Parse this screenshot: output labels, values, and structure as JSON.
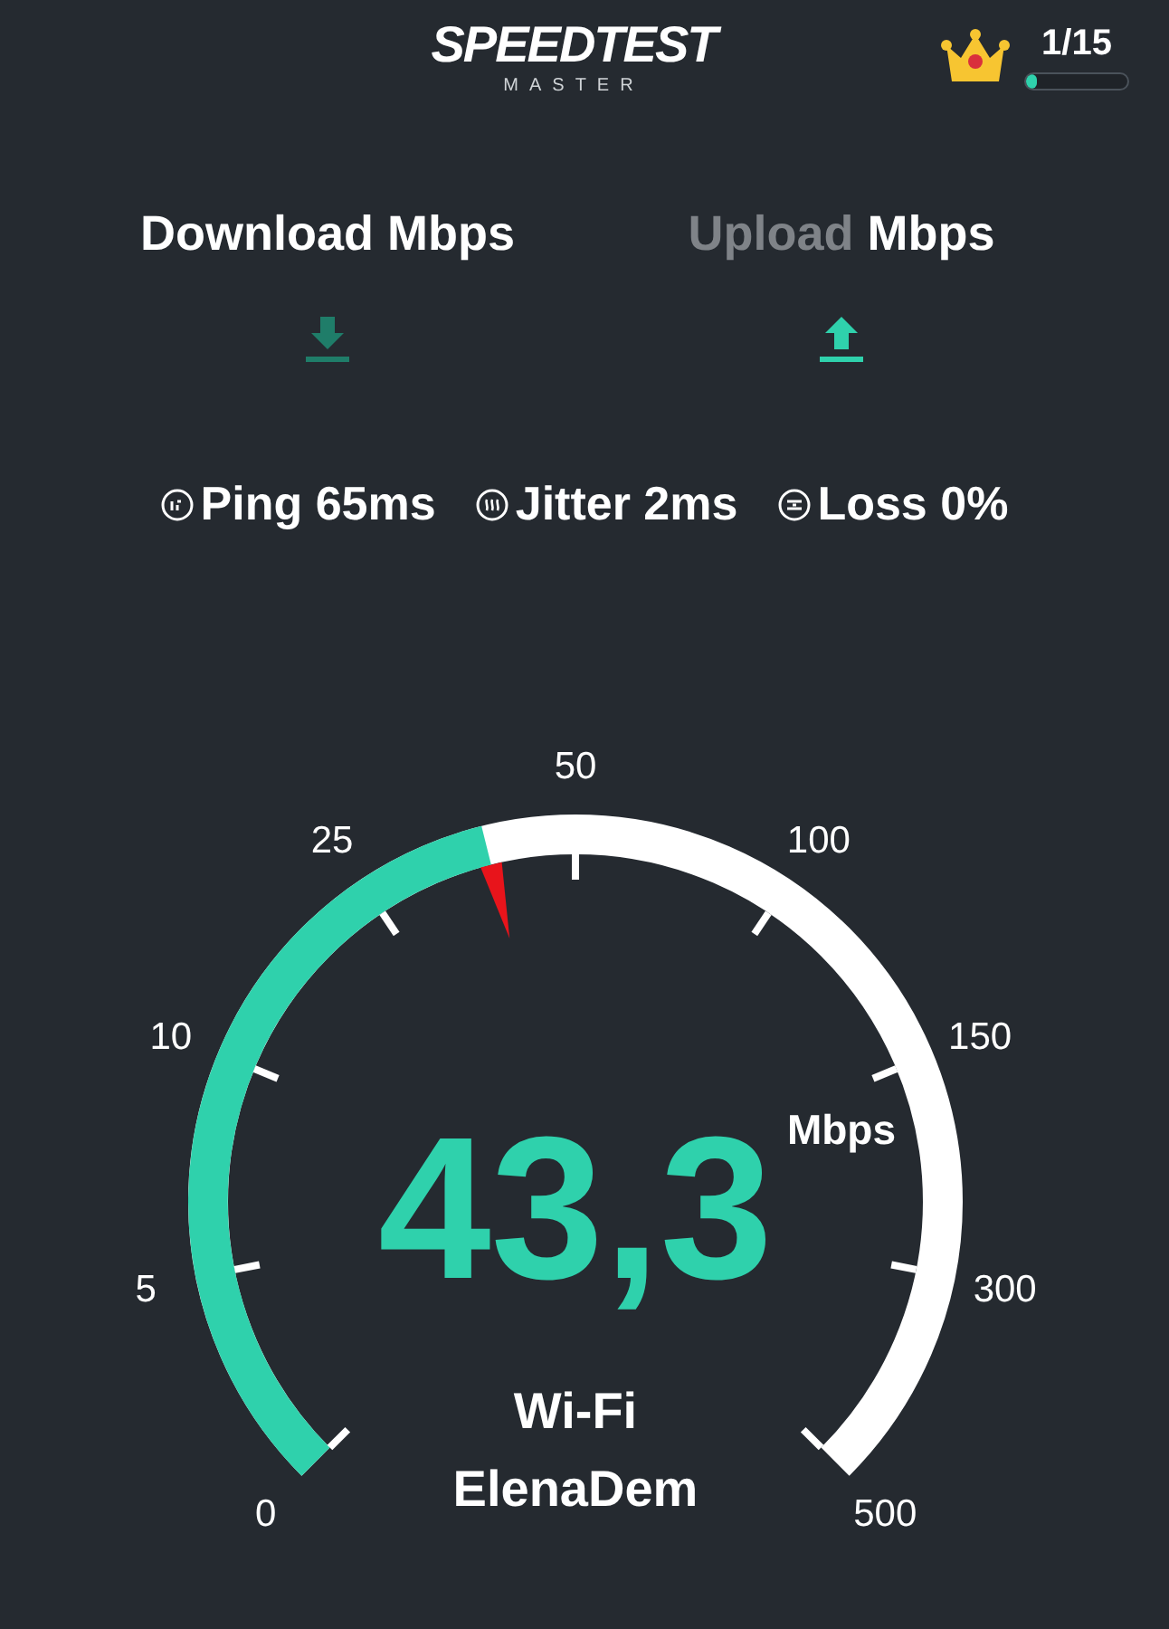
{
  "header": {
    "logo_title": "SPEEDTEST",
    "logo_subtitle": "MASTER",
    "rank": "1/15",
    "rank_progress": {
      "level": 0.1
    }
  },
  "tabs": [
    {
      "label": "Download",
      "unit": "Mbps",
      "selected": false,
      "kind": "download"
    },
    {
      "label": "Upload",
      "unit": "Mbps",
      "selected": true,
      "kind": "upload"
    }
  ],
  "metrics": [
    {
      "kind": "ping",
      "text": "Ping 65ms"
    },
    {
      "kind": "jitter",
      "text": "Jitter 2ms"
    },
    {
      "kind": "loss",
      "text": "Loss 0%"
    }
  ],
  "gauge": {
    "scale": [
      "0",
      "5",
      "10",
      "25",
      "50",
      "100",
      "150",
      "300",
      "500"
    ],
    "value": "43,3",
    "unit": "Mbps",
    "connection": "Wi‑Fi",
    "network": "ElenaDem"
  }
}
